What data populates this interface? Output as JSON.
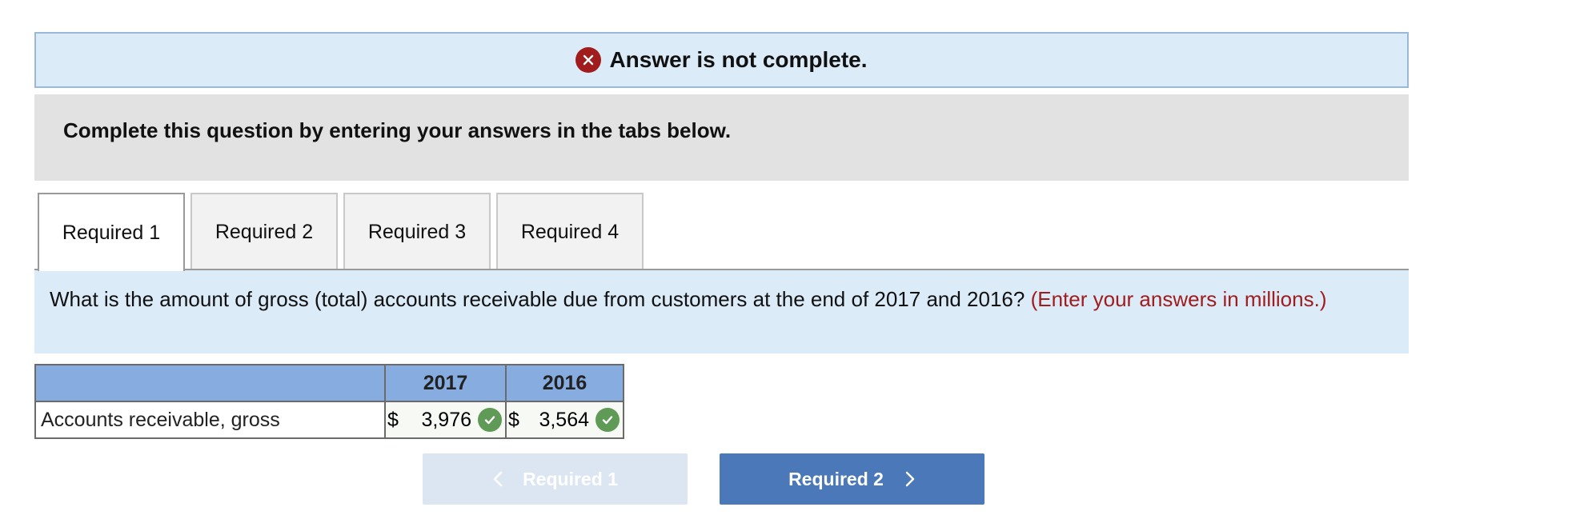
{
  "banner": {
    "icon": "x-circle-icon",
    "text": "Answer is not complete.",
    "icon_color": "#a11c1c"
  },
  "instructions": "Complete this question by entering your answers in the tabs below.",
  "tabs": [
    {
      "label": "Required 1",
      "active": true
    },
    {
      "label": "Required 2",
      "active": false
    },
    {
      "label": "Required 3",
      "active": false
    },
    {
      "label": "Required 4",
      "active": false
    }
  ],
  "question": {
    "text": "What is the amount of gross (total) accounts receivable due from customers at the end of 2017 and 2016?",
    "hint": "(Enter your answers in millions.)"
  },
  "table": {
    "headers": [
      "",
      "2017",
      "2016"
    ],
    "rows": [
      {
        "label": "Accounts receivable, gross",
        "cells": [
          {
            "currency": "$",
            "value": "3,976",
            "status": "correct"
          },
          {
            "currency": "$",
            "value": "3,564",
            "status": "correct"
          }
        ]
      }
    ]
  },
  "nav": {
    "prev_label": "Required 1",
    "next_label": "Required 2",
    "prev_enabled": false
  },
  "colors": {
    "header_blue": "#86ace0",
    "banner_bg": "#dcebf8",
    "correct_green": "#5f9a56",
    "next_button": "#4a78b8",
    "hint_red": "#a11c1c"
  }
}
